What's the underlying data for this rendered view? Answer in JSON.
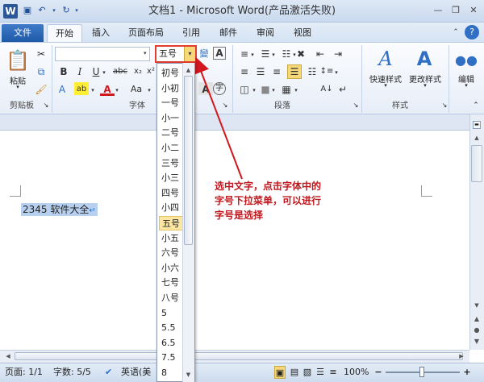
{
  "window": {
    "title": "文档1 - Microsoft Word(产品激活失败)",
    "logo": "W"
  },
  "icons": {
    "save": "save-icon",
    "undo": "undo-icon",
    "redo": "redo-icon",
    "minimize": "minimize-icon",
    "restore": "restore-icon",
    "close": "close-icon",
    "help": "help-icon"
  },
  "tabs": [
    "文件",
    "开始",
    "插入",
    "页面布局",
    "引用",
    "邮件",
    "审阅",
    "视图"
  ],
  "ribbon": {
    "clipboard": {
      "paste_label": "粘贴",
      "group_label": "剪贴板"
    },
    "font": {
      "group_label": "字体",
      "size_value": "五号"
    },
    "paragraph": {
      "group_label": "段落"
    },
    "styles": {
      "quick_styles": "快速样式",
      "change_styles": "更改样式",
      "group_label": "样式"
    },
    "editing": {
      "label": "编辑"
    }
  },
  "font_size_options": [
    "初号",
    "小初",
    "一号",
    "小一",
    "二号",
    "小二",
    "三号",
    "小三",
    "四号",
    "小四",
    "五号",
    "小五",
    "六号",
    "小六",
    "七号",
    "八号",
    "5",
    "5.5",
    "6.5",
    "7.5",
    "8"
  ],
  "selected_size": "五号",
  "document": {
    "text": "2345 软件大全"
  },
  "annotation": {
    "line1": "选中文字，点击字体中的",
    "line2": "字号下拉菜单，可以进行",
    "line3": "字号是选择"
  },
  "status": {
    "page": "页面: 1/1",
    "words": "字数: 5/5",
    "language": "英语(美",
    "zoom": "100%"
  },
  "colors": {
    "accent_red": "#e43c2e",
    "annotation_red": "#c0181e",
    "file_tab_blue": "#1e5aa8",
    "selection": "#b7d0ef"
  }
}
